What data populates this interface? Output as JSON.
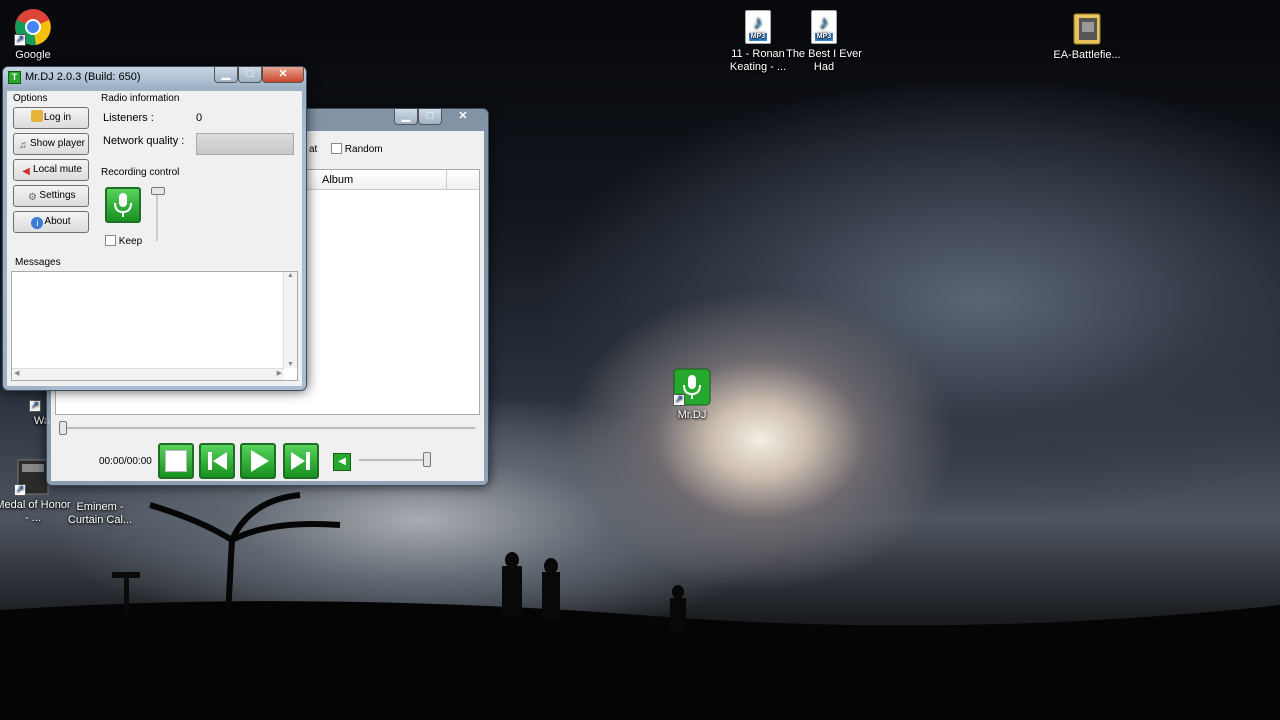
{
  "desktop": {
    "icons": [
      {
        "id": "google",
        "label": "Google"
      },
      {
        "id": "mp3-1",
        "label": "11 - Ronan Keating - ..."
      },
      {
        "id": "mp3-2",
        "label": "The Best I Ever Had"
      },
      {
        "id": "ea",
        "label": "EA-Battlefie..."
      },
      {
        "id": "mrdj",
        "label": "Mr.DJ"
      },
      {
        "id": "warl",
        "label": "Warl"
      },
      {
        "id": "medal",
        "label": "Medal of Honor - ..."
      },
      {
        "id": "eminem",
        "label": "Eminem - Curtain Cal..."
      }
    ],
    "mp3_badge": "MP3"
  },
  "mrdj_window": {
    "title": "Mr.DJ 2.0.3 (Build: 650)",
    "options_label": "Options",
    "buttons": {
      "login": "Log in",
      "show_player": "Show player",
      "local_mute": "Local mute",
      "settings": "Settings",
      "about": "About"
    },
    "radio_info_label": "Radio information",
    "listeners_label": "Listeners :",
    "listeners_value": "0",
    "network_quality_label": "Network quality :",
    "recording_label": "Recording control",
    "keep_label": "Keep",
    "messages_label": "Messages"
  },
  "player_window": {
    "repeat_partial": "at",
    "random_label": "Random",
    "column_album": "Album",
    "time": "00:00/00:00"
  }
}
